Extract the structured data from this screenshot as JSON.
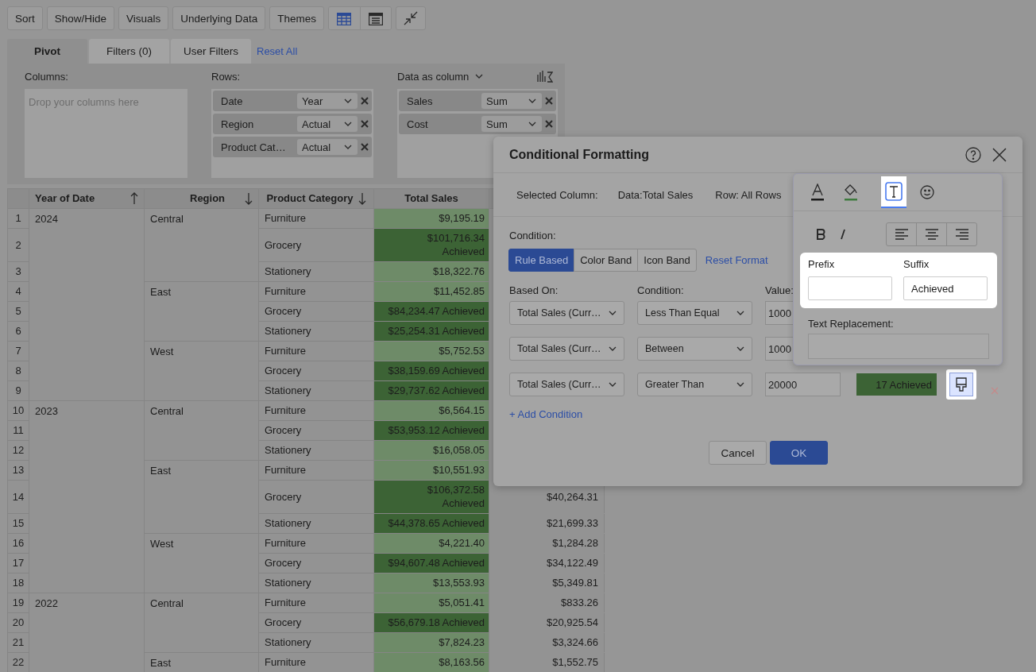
{
  "toolbar": {
    "buttons": [
      "Sort",
      "Show/Hide",
      "Visuals",
      "Underlying Data",
      "Themes"
    ]
  },
  "tabs": [
    {
      "label": "Pivot",
      "selected": true
    },
    {
      "label": "Filters (0)",
      "selected": false
    },
    {
      "label": "User Filters",
      "selected": false
    }
  ],
  "reset_all": "Reset All",
  "pivot": {
    "columns": {
      "label": "Columns:",
      "placeholder": "Drop your columns here"
    },
    "rows": {
      "label": "Rows:",
      "items": [
        {
          "field": "Date",
          "option": "Year"
        },
        {
          "field": "Region",
          "option": "Actual"
        },
        {
          "field": "Product Cat…",
          "option": "Actual"
        }
      ]
    },
    "data": {
      "label": "Data as column",
      "items": [
        {
          "field": "Sales",
          "option": "Sum"
        },
        {
          "field": "Cost",
          "option": "Sum"
        }
      ]
    }
  },
  "table": {
    "columns": [
      {
        "label": "Year of Date",
        "kind": "ascending"
      },
      {
        "label": "Region",
        "kind": "descending"
      },
      {
        "label": "Product Category",
        "kind": "descending"
      },
      {
        "label": "Total Sales",
        "kind": "plain"
      }
    ],
    "groups": [
      {
        "year": "2024",
        "regions": [
          {
            "region": "Central",
            "rows": [
              {
                "number": "1",
                "category": "Furniture",
                "total_sales": "$9,195.19",
                "color": "#6e8b68"
              },
              {
                "number": "2",
                "category": "Grocery",
                "total_sales": "$101,716.34 Achieved",
                "color": "#3c6335"
              },
              {
                "number": "3",
                "category": "Stationery",
                "total_sales": "$18,322.76",
                "color": "#6e8b68"
              }
            ]
          },
          {
            "region": "East",
            "rows": [
              {
                "number": "4",
                "category": "Furniture",
                "total_sales": "$11,452.85",
                "color": "#6e8b68"
              },
              {
                "number": "5",
                "category": "Grocery",
                "total_sales": "$84,234.47 Achieved",
                "color": "#3c6335"
              },
              {
                "number": "6",
                "category": "Stationery",
                "total_sales": "$25,254.31 Achieved",
                "color": "#3c6335"
              }
            ]
          },
          {
            "region": "West",
            "rows": [
              {
                "number": "7",
                "category": "Furniture",
                "total_sales": "$5,752.53",
                "color": "#6e8b68"
              },
              {
                "number": "8",
                "category": "Grocery",
                "total_sales": "$38,159.69 Achieved",
                "color": "#3c6335"
              },
              {
                "number": "9",
                "category": "Stationery",
                "total_sales": "$29,737.62 Achieved",
                "color": "#3c6335"
              }
            ]
          }
        ]
      },
      {
        "year": "2023",
        "regions": [
          {
            "region": "Central",
            "rows": [
              {
                "number": "10",
                "category": "Furniture",
                "total_sales": "$6,564.15",
                "color": "#6e8b68"
              },
              {
                "number": "11",
                "category": "Grocery",
                "total_sales": "$53,953.12 Achieved",
                "color": "#3c6335"
              },
              {
                "number": "12",
                "category": "Stationery",
                "total_sales": "$16,058.05",
                "color": "#6e8b68"
              }
            ]
          },
          {
            "region": "East",
            "rows": [
              {
                "number": "13",
                "category": "Furniture",
                "total_sales": "$10,551.93",
                "color": "#6e8b68"
              },
              {
                "number": "14",
                "category": "Grocery",
                "total_sales": "$106,372.58 Achieved",
                "color": "#3c6335",
                "column_5": "$40,264.31"
              },
              {
                "number": "15",
                "category": "Stationery",
                "total_sales": "$44,378.65 Achieved",
                "color": "#3c6335",
                "column_5": "$21,699.33"
              }
            ]
          },
          {
            "region": "West",
            "rows": [
              {
                "number": "16",
                "category": "Furniture",
                "total_sales": "$4,221.40",
                "color": "#6e8b68",
                "column_5": "$1,284.28"
              },
              {
                "number": "17",
                "category": "Grocery",
                "total_sales": "$94,607.48 Achieved",
                "color": "#3c6335",
                "column_5": "$34,122.49"
              },
              {
                "number": "18",
                "category": "Stationery",
                "total_sales": "$13,553.93",
                "color": "#6e8b68",
                "column_5": "$5,349.81"
              }
            ]
          }
        ]
      },
      {
        "year": "2022",
        "regions": [
          {
            "region": "Central",
            "rows": [
              {
                "number": "19",
                "category": "Furniture",
                "total_sales": "$5,051.41",
                "color": "#6e8b68",
                "column_5": "$833.26"
              },
              {
                "number": "20",
                "category": "Grocery",
                "total_sales": "$56,679.18 Achieved",
                "color": "#3c6335",
                "column_5": "$20,925.54"
              },
              {
                "number": "21",
                "category": "Stationery",
                "total_sales": "$7,824.23",
                "color": "#6e8b68",
                "column_5": "$3,324.66"
              }
            ]
          },
          {
            "region": "East",
            "rows": [
              {
                "number": "22",
                "category": "Furniture",
                "total_sales": "$8,163.56",
                "color": "#6e8b68",
                "column_5": "$1,552.75"
              }
            ]
          }
        ]
      }
    ]
  },
  "dialog": {
    "title": "Conditional Formatting",
    "selected_column_label": "Selected Column:",
    "selected_column": "Data:Total Sales",
    "row_scope": "Row: All Rows",
    "condition_label": "Condition:",
    "modes": [
      {
        "label": "Rule Based",
        "selected": true
      },
      {
        "label": "Color Band",
        "selected": false
      },
      {
        "label": "Icon Band",
        "selected": false
      }
    ],
    "reset_format": "Reset Format",
    "headers": [
      "Based On:",
      "Condition:",
      "Value:"
    ],
    "rules": [
      {
        "based_on": "Total Sales (Curr…",
        "condition": "Less Than Equal",
        "value": "1000"
      },
      {
        "based_on": "Total Sales (Curr…",
        "condition": "Between",
        "value": "1000"
      },
      {
        "based_on": "Total Sales (Curr…",
        "condition": "Greater Than",
        "value": "20000",
        "preview": "17 Achieved",
        "color": "#3c6335"
      }
    ],
    "add_condition": "+ Add Condition",
    "cancel": "Cancel",
    "ok": "OK",
    "format_popover": {
      "tabs": [
        {
          "kind": "font-color",
          "selected": false
        },
        {
          "kind": "fill",
          "selected": false
        },
        {
          "kind": "text",
          "selected": true
        },
        {
          "kind": "icon",
          "selected": false
        }
      ],
      "prefix_label": "Prefix",
      "suffix_label": "Suffix",
      "suffix_value": "Achieved",
      "text_replacement_label": "Text Replacement:"
    }
  }
}
